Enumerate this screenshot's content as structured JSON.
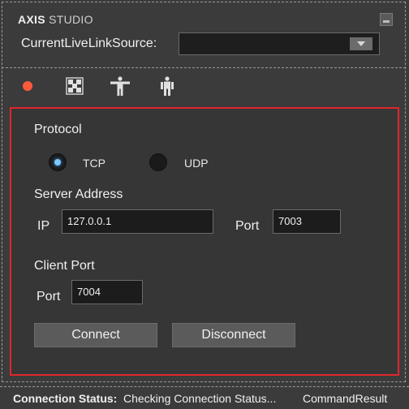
{
  "header": {
    "brand_bold": "AXIS",
    "brand_light": " STUDIO",
    "source_label": "CurrentLiveLinkSource:",
    "source_value": ""
  },
  "toolbar": {
    "items": [
      {
        "name": "record",
        "icon": "record-dot-icon"
      },
      {
        "name": "skeleton-grid",
        "icon": "skeleton-grid-icon"
      },
      {
        "name": "t-pose",
        "icon": "t-pose-icon"
      },
      {
        "name": "figure",
        "icon": "standing-figure-icon"
      }
    ]
  },
  "form": {
    "protocol_label": "Protocol",
    "protocol_options": [
      {
        "label": "TCP",
        "selected": true
      },
      {
        "label": "UDP",
        "selected": false
      }
    ],
    "server_address_label": "Server Address",
    "ip_label": "IP",
    "ip_value": "127.0.0.1",
    "server_port_label": "Port",
    "server_port_value": "7003",
    "client_port_label": "Client Port",
    "client_port_field_label": "Port",
    "client_port_value": "7004",
    "connect_label": "Connect",
    "disconnect_label": "Disconnect"
  },
  "status": {
    "key": "Connection Status:",
    "value": "Checking Connection Status...",
    "result": "CommandResult"
  },
  "colors": {
    "accent_border": "#e0262c",
    "record": "#ff5a3c",
    "radio_selected": "#7cc8ff"
  }
}
